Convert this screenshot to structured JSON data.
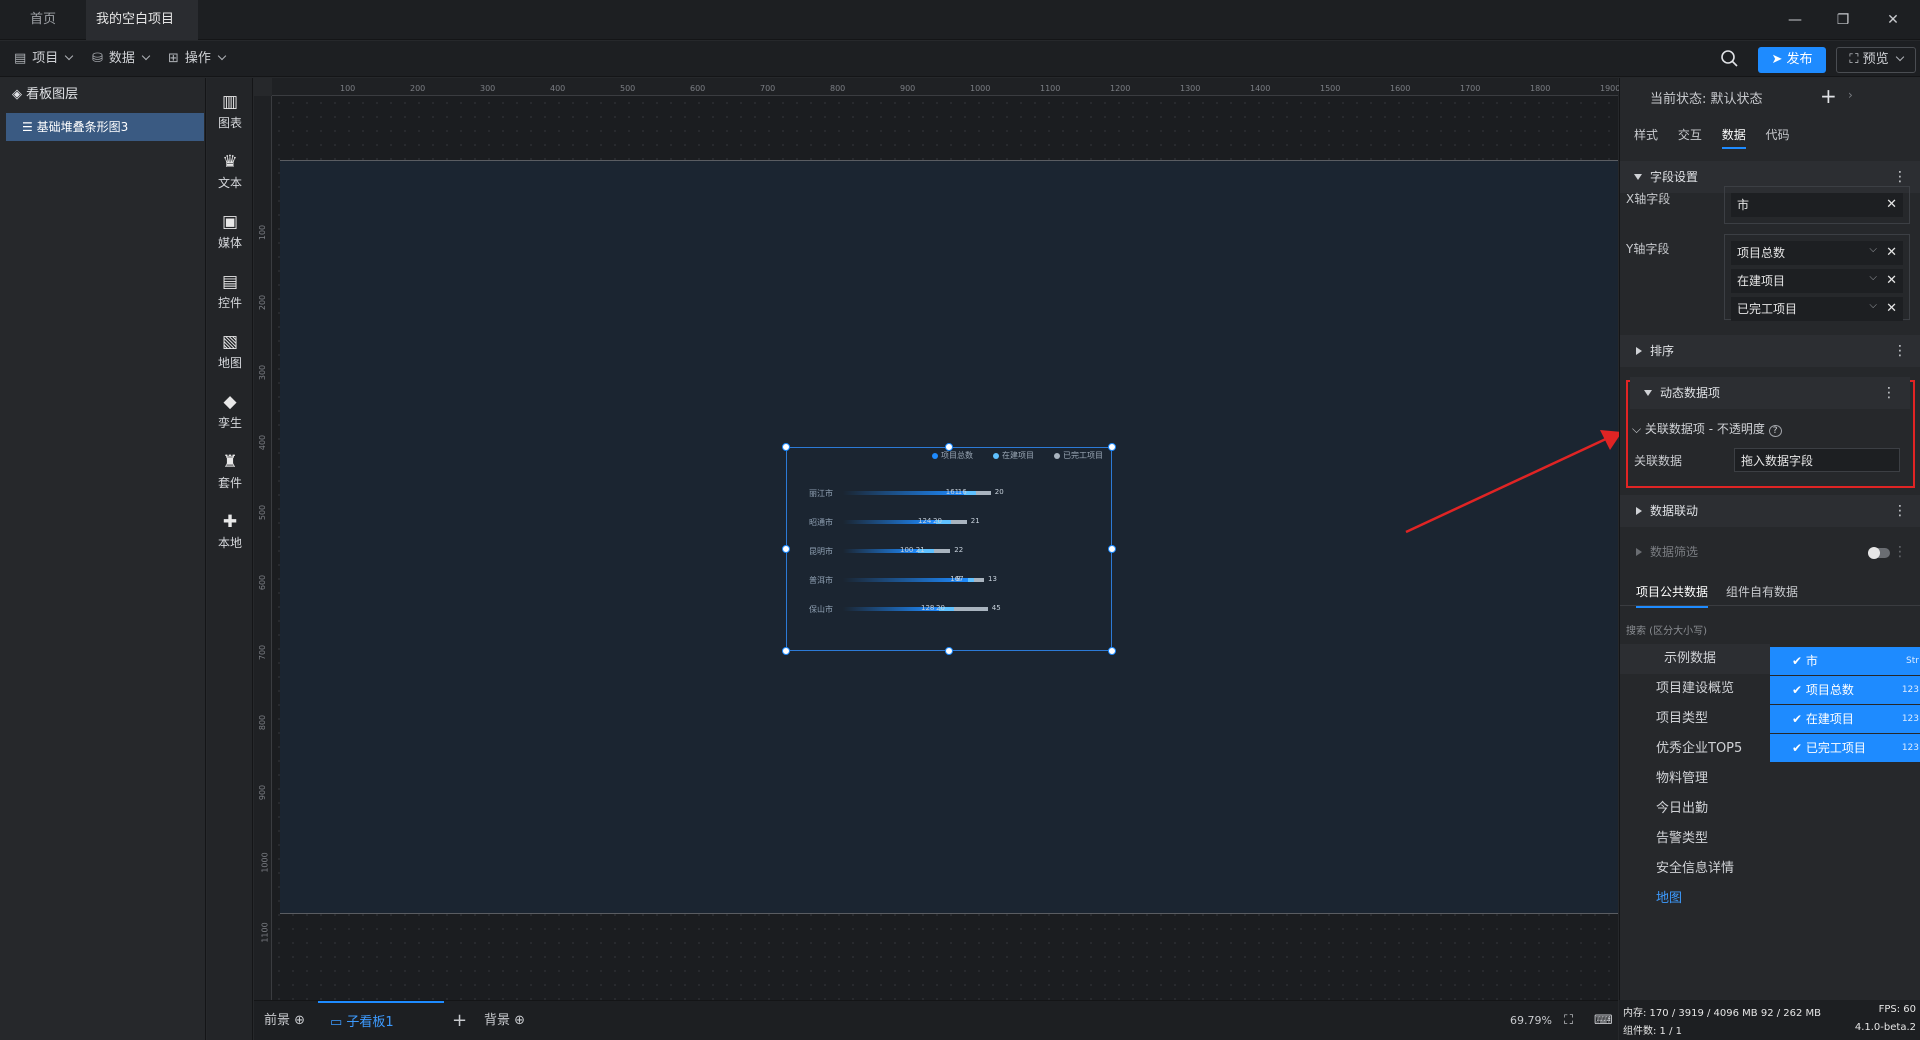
{
  "tabs": {
    "home": "首页",
    "project": "我的空白项目"
  },
  "menu": {
    "project": "项目",
    "data": "数据",
    "operate": "操作",
    "publish": "发布",
    "preview": "预览"
  },
  "layers": {
    "title": "看板图层",
    "item": "基础堆叠条形图3"
  },
  "tools": [
    "图表",
    "文本",
    "媒体",
    "控件",
    "地图",
    "孪生",
    "套件",
    "本地"
  ],
  "ruler": {
    "top": [
      "100",
      "200",
      "300",
      "400",
      "500",
      "600",
      "700",
      "800",
      "900",
      "1000",
      "1100",
      "1200",
      "1300",
      "1400",
      "1500",
      "1600",
      "1700",
      "1800",
      "1900"
    ],
    "left": [
      "100",
      "200",
      "300",
      "400",
      "500",
      "600",
      "700",
      "800",
      "900",
      "1000",
      "1100"
    ]
  },
  "chart_data": {
    "type": "bar",
    "orientation": "horizontal",
    "stacked": true,
    "categories": [
      "丽江市",
      "昭通市",
      "昆明市",
      "普洱市",
      "保山市"
    ],
    "series": [
      {
        "name": "项目总数",
        "values": [
          161,
          124,
          100,
          167,
          128
        ],
        "color": "#1e8bff"
      },
      {
        "name": "在建项目",
        "values": [
          16,
          20,
          21,
          8,
          20
        ],
        "color": "#5fc1ff"
      },
      {
        "name": "已完工项目",
        "values": [
          20,
          21,
          22,
          13,
          45
        ],
        "color": "#a9b4bf"
      }
    ],
    "value_labels": [
      [
        "161",
        "16",
        "20"
      ],
      [
        "124",
        "20",
        "21"
      ],
      [
        "100",
        "21",
        "22"
      ],
      [
        "167",
        "8",
        "13"
      ],
      [
        "128",
        "20",
        "45"
      ]
    ],
    "legend": "top-right"
  },
  "bottom": {
    "front": "前景",
    "board": "子看板1",
    "back": "背景",
    "zoom": "69.79%"
  },
  "right": {
    "status_label": "当前状态:",
    "status_value": "默认状态",
    "tabs": [
      "样式",
      "交互",
      "数据",
      "代码"
    ],
    "field_settings": "字段设置",
    "x_label": "X轴字段",
    "x_value": "市",
    "y_label": "Y轴字段",
    "y_values": [
      "项目总数",
      "在建项目",
      "已完工项目"
    ],
    "sort": "排序",
    "dynamic": "动态数据项",
    "link_opacity": "关联数据项 - 不透明度",
    "link_data": "关联数据",
    "drag_placeholder": "拖入数据字段",
    "linkage": "数据联动",
    "filter": "数据筛选",
    "source_tabs": [
      "项目公共数据",
      "组件自有数据"
    ],
    "search_placeholder": "搜索 (区分大小写)",
    "categories": [
      "示例数据",
      "项目建设概览",
      "项目类型",
      "优秀企业TOP5",
      "物料管理",
      "今日出勤",
      "告警类型",
      "安全信息详情",
      "地图"
    ],
    "selected_fields": [
      {
        "name": "市",
        "type": "Str"
      },
      {
        "name": "项目总数",
        "type": "123"
      },
      {
        "name": "在建项目",
        "type": "123"
      },
      {
        "name": "已完工项目",
        "type": "123"
      }
    ]
  },
  "status": {
    "memory": "内存: 170 / 3919 / 4096 MB 92 / 262 MB",
    "fps": "FPS: 60",
    "components": "组件数: 1 / 1",
    "version": "4.1.0-beta.2"
  },
  "colors": {
    "accent": "#1e8bff",
    "highlight_box": "#e02424",
    "arrow": "#e02424"
  }
}
